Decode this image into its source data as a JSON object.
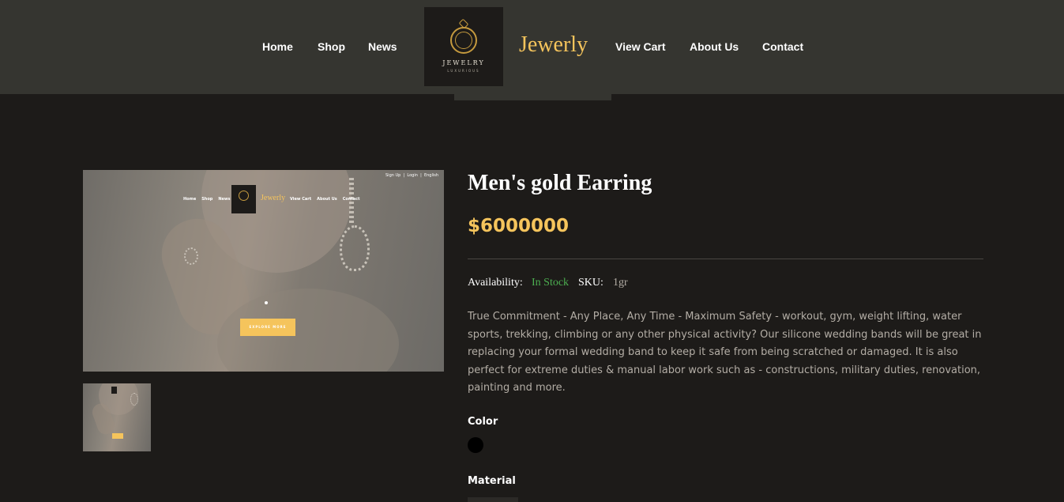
{
  "header": {
    "nav_left": [
      "Home",
      "Shop",
      "News"
    ],
    "nav_right": [
      "View Cart",
      "About Us",
      "Contact"
    ],
    "logo_text": "JEWELRY",
    "logo_subtext": "LUXURIOUS",
    "brand": "Jewerly"
  },
  "product_image": {
    "topbar_links": [
      "Sign Up",
      "Login",
      "English"
    ],
    "nav_left": [
      "Home",
      "Shop",
      "News"
    ],
    "nav_right": [
      "View Cart",
      "About Us",
      "Contact"
    ],
    "brand": "Jewerly",
    "button_label": "EXPLORE MORE"
  },
  "product": {
    "title": "Men's gold Earring",
    "price": "$6000000",
    "availability_label": "Availability:",
    "availability_value": "In Stock",
    "sku_label": "SKU:",
    "sku_value": "1gr",
    "description": "True Commitment - Any Place, Any Time - Maximum Safety - workout, gym, weight lifting, water sports, trekking, climbing or any other physical activity? Our silicone wedding bands will be great in replacing your formal wedding band to keep it safe from being scratched or damaged. It is also perfect for extreme duties & manual labor work such as - constructions, military duties, renovation, painting and more.",
    "color_label": "Color",
    "color_swatch": "#000000",
    "material_label": "Material"
  },
  "colors": {
    "accent": "#f5c45c",
    "in_stock": "#4caf50",
    "header_bg": "#353530",
    "page_bg": "#1d1b19"
  }
}
